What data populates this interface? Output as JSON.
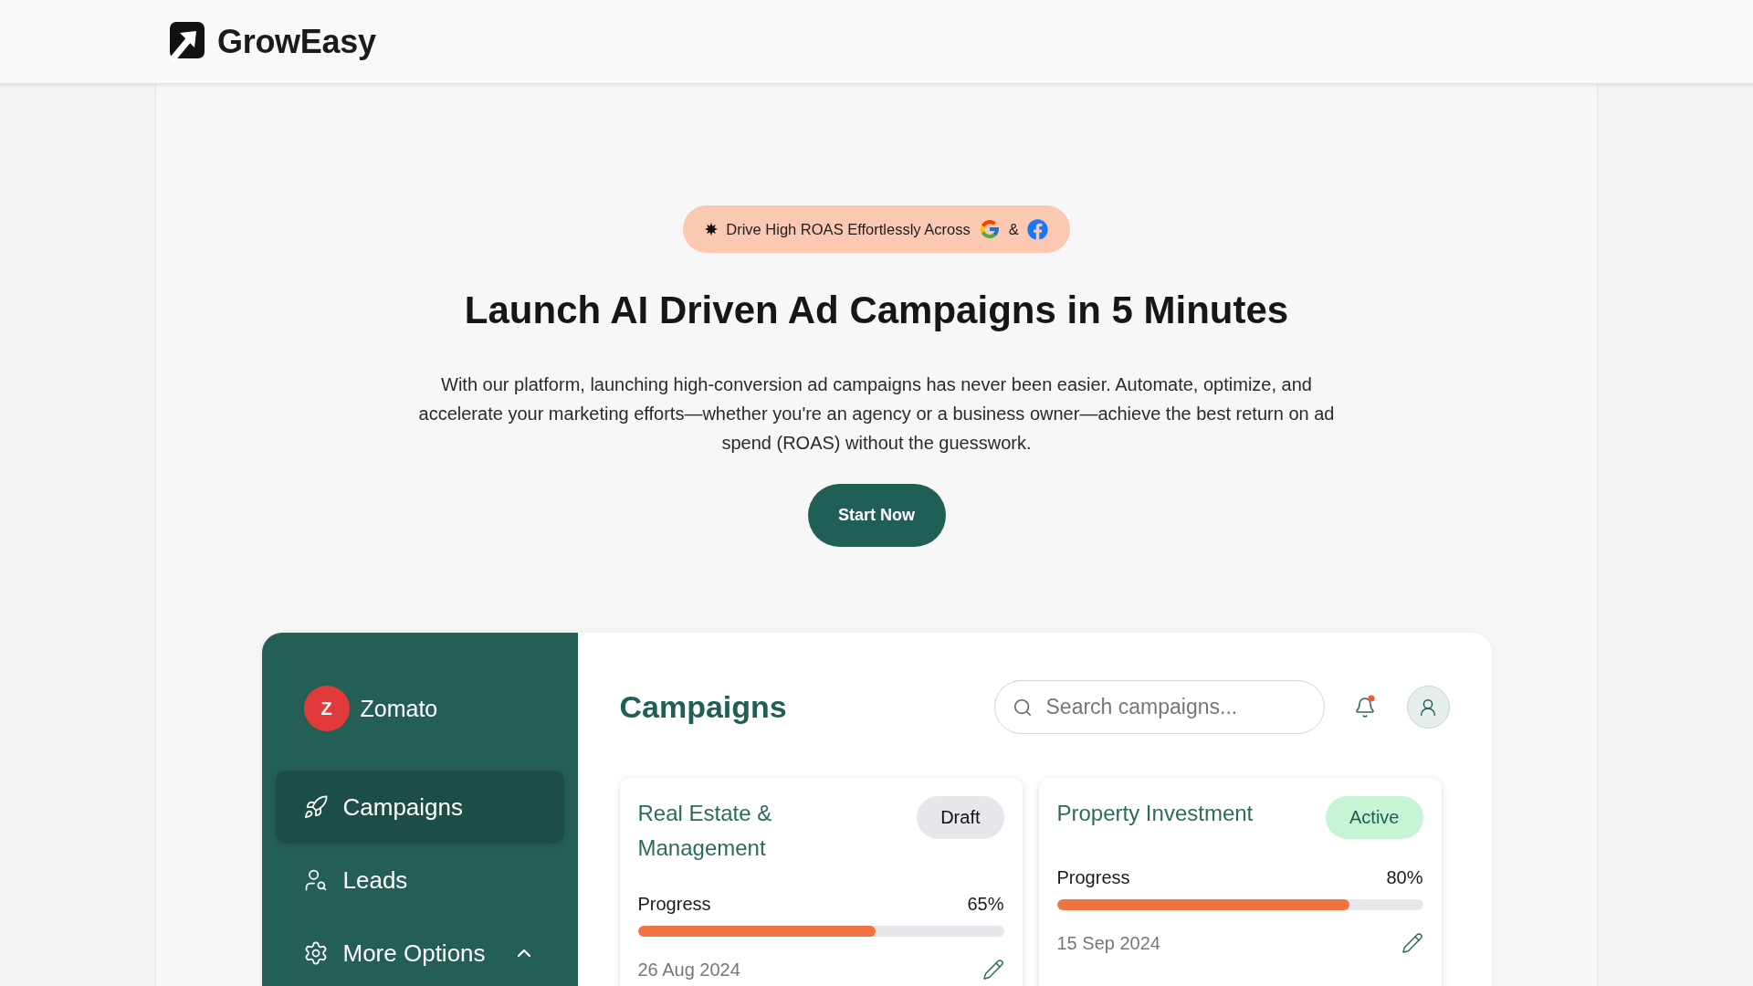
{
  "header": {
    "brand": "GrowEasy"
  },
  "hero": {
    "badge": {
      "text": "Drive High ROAS Effortlessly Across",
      "joiner": "&"
    },
    "title": "Launch AI Driven Ad Campaigns in 5 Minutes",
    "description": "With our platform, launching high-conversion ad campaigns has never been easier. Automate, optimize, and accelerate your marketing efforts—whether you're an agency or a business owner—achieve the best return on ad spend (ROAS) without the guesswork.",
    "cta": "Start Now"
  },
  "dashboard": {
    "sidebar": {
      "workspace": {
        "initial": "Z",
        "name": "Zomato"
      },
      "items": [
        {
          "label": "Campaigns",
          "kind": "link",
          "selected": true
        },
        {
          "label": "Leads",
          "kind": "link",
          "selected": false
        },
        {
          "label": "More Options",
          "kind": "group",
          "selected": false,
          "expanded": true
        }
      ]
    },
    "main": {
      "title": "Campaigns",
      "search": {
        "placeholder": "Search campaigns..."
      },
      "notifications": {
        "unread": true
      },
      "cards": [
        {
          "title": "Real Estate & Management",
          "status": {
            "label": "Draft",
            "kind": "draft"
          },
          "progress": {
            "label": "Progress",
            "reading": "65%",
            "level": 0.65
          },
          "date": "26 Aug 2024"
        },
        {
          "title": "Property Investment",
          "status": {
            "label": "Active",
            "kind": "active"
          },
          "progress": {
            "label": "Progress",
            "reading": "80%",
            "level": 0.8
          },
          "date": "15 Sep 2024"
        }
      ]
    }
  }
}
